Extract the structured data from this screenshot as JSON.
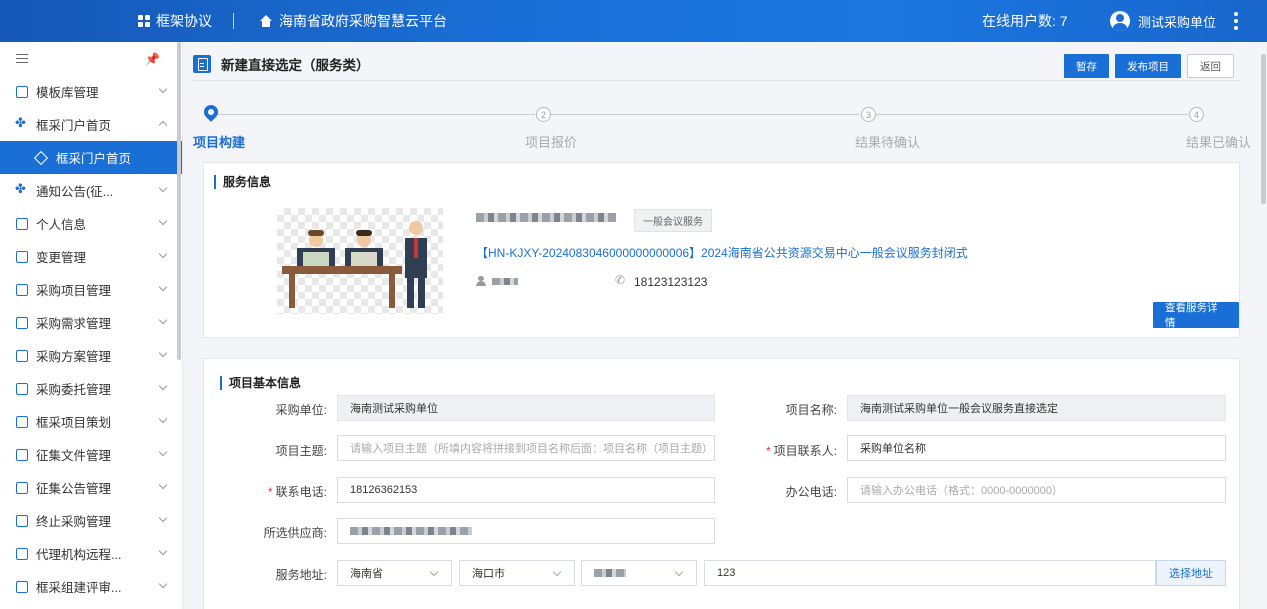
{
  "topbar": {
    "module": "框架协议",
    "platform": "海南省政府采购智慧云平台",
    "online_users": "在线用户数: 7",
    "username": "测试采购单位"
  },
  "sidebar": {
    "items": [
      {
        "label": "模板库管理",
        "icon": "template-icon"
      },
      {
        "label": "框采门户首页",
        "icon": "cluster-icon"
      },
      {
        "label": "框采门户首页",
        "icon": "diamond-icon"
      },
      {
        "label": "通知公告(征...",
        "icon": "cluster-icon"
      },
      {
        "label": "个人信息",
        "icon": "user-card-icon"
      },
      {
        "label": "变更管理",
        "icon": "change-icon"
      },
      {
        "label": "采购项目管理",
        "icon": "folder-icon"
      },
      {
        "label": "采购需求管理",
        "icon": "requirement-icon"
      },
      {
        "label": "采购方案管理",
        "icon": "plan-icon"
      },
      {
        "label": "采购委托管理",
        "icon": "entrust-icon"
      },
      {
        "label": "框采项目策划",
        "icon": "project-icon"
      },
      {
        "label": "征集文件管理",
        "icon": "file-icon"
      },
      {
        "label": "征集公告管理",
        "icon": "notice-icon"
      },
      {
        "label": "终止采购管理",
        "icon": "terminate-icon"
      },
      {
        "label": "代理机构远程...",
        "icon": "agency-icon"
      },
      {
        "label": "框采组建评审...",
        "icon": "review-icon"
      }
    ]
  },
  "page": {
    "title": "新建直接选定（服务类）",
    "buttons": {
      "save": "暂存",
      "publish": "发布项目",
      "back": "返回"
    }
  },
  "steps": [
    {
      "num": "",
      "label": "项目构建"
    },
    {
      "num": "2",
      "label": "项目报价"
    },
    {
      "num": "3",
      "label": "结果待确认"
    },
    {
      "num": "4",
      "label": "结果已确认"
    }
  ],
  "service": {
    "section_title": "服务信息",
    "tag": "一般会议服务",
    "project_link": "【HN-KJXY-2024083046000000000006】2024海南省公共资源交易中心一般会议服务封闭式",
    "phone": "18123123123",
    "detail_button": "查看服务详情"
  },
  "form": {
    "section_title": "项目基本信息",
    "purchaser_label": "采购单位:",
    "purchaser_value": "海南测试采购单位",
    "project_name_label": "项目名称:",
    "project_name_value": "海南测试采购单位一般会议服务直接选定",
    "subject_label": "项目主题:",
    "subject_placeholder": "请输入项目主题（所填内容将拼接到项目名称后面：项目名称（项目主题）",
    "contact_label": "项目联系人:",
    "contact_value": "采购单位名称",
    "phone_label": "联系电话:",
    "phone_value": "18126362153",
    "office_phone_label": "办公电话:",
    "office_phone_placeholder": "请输入办公电话（格式：0000-0000000）",
    "supplier_label": "所选供应商:",
    "address_label": "服务地址:",
    "province": "海南省",
    "city": "海口市",
    "address_detail": "123",
    "address_button": "选择地址"
  }
}
